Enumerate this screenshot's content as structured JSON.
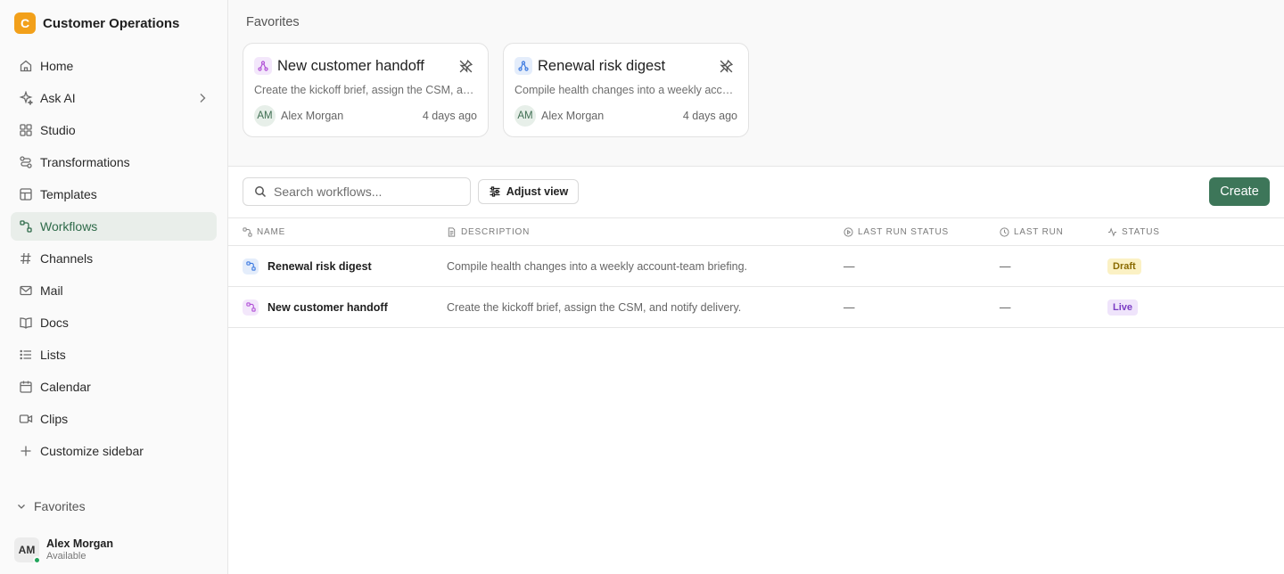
{
  "sidebar": {
    "workspace": {
      "initial": "C",
      "name": "Customer Operations"
    },
    "items": [
      {
        "label": "Home",
        "icon": "home-icon"
      },
      {
        "label": "Ask AI",
        "icon": "sparkle-icon"
      },
      {
        "label": "Studio",
        "icon": "grid-icon"
      },
      {
        "label": "Transformations",
        "icon": "transform-icon"
      },
      {
        "label": "Templates",
        "icon": "template-icon"
      },
      {
        "label": "Workflows",
        "icon": "workflow-icon",
        "active": true
      },
      {
        "label": "Channels",
        "icon": "hash-icon"
      },
      {
        "label": "Mail",
        "icon": "mail-icon"
      },
      {
        "label": "Docs",
        "icon": "book-icon"
      },
      {
        "label": "Lists",
        "icon": "list-icon"
      },
      {
        "label": "Calendar",
        "icon": "calendar-icon"
      },
      {
        "label": "Clips",
        "icon": "video-icon"
      },
      {
        "label": "Customize sidebar",
        "icon": "plus-icon"
      }
    ],
    "favorites_label": "Favorites",
    "user": {
      "initials": "AM",
      "name": "Alex Morgan",
      "status": "Available"
    }
  },
  "favorites": {
    "title": "Favorites",
    "cards": [
      {
        "title": "New customer handoff",
        "description": "Create the kickoff brief, assign the CSM, and notify delivery.",
        "owner_initials": "AM",
        "owner": "Alex Morgan",
        "time": "4 days ago",
        "accent": "#b04fd6"
      },
      {
        "title": "Renewal risk digest",
        "description": "Compile health changes into a weekly account-team briefing.",
        "owner_initials": "AM",
        "owner": "Alex Morgan",
        "time": "4 days ago",
        "accent": "#3a78e0"
      }
    ]
  },
  "toolbar": {
    "search_placeholder": "Search workflows...",
    "adjust_label": "Adjust view",
    "create_label": "Create"
  },
  "table": {
    "columns": [
      "NAME",
      "DESCRIPTION",
      "LAST RUN STATUS",
      "LAST RUN",
      "STATUS"
    ],
    "rows": [
      {
        "name": "Renewal risk digest",
        "description": "Compile health changes into a weekly account-team briefing.",
        "last_run_status": "—",
        "last_run": "—",
        "status": "Draft",
        "accent": "#3a78e0"
      },
      {
        "name": "New customer handoff",
        "description": "Create the kickoff brief, assign the CSM, and notify delivery.",
        "last_run_status": "—",
        "last_run": "—",
        "status": "Live",
        "accent": "#b04fd6"
      }
    ]
  },
  "colors": {
    "accent_green": "#3d7659",
    "workspace_logo": "#f2a01a"
  }
}
